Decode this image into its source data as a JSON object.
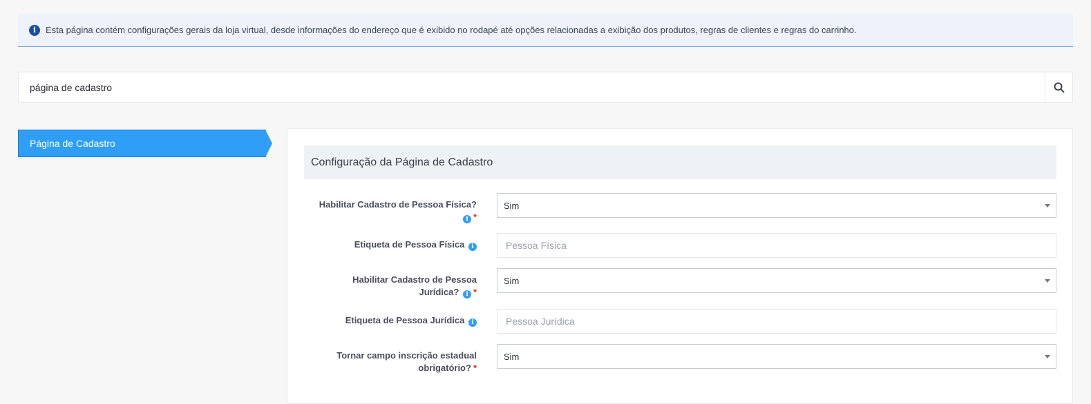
{
  "info": {
    "text": "Esta página contém configurações gerais da loja virtual, desde informações do endereço que é exibido no rodapé até opções relacionadas a exibição dos produtos, regras de clientes e regras do carrinho.",
    "icon": "info-icon"
  },
  "search": {
    "value": "página de cadastro",
    "icon": "search-icon"
  },
  "sidebar": {
    "items": [
      {
        "label": "Página de Cadastro",
        "active": true
      }
    ]
  },
  "panel": {
    "title": "Configuração da Página de Cadastro",
    "fields": [
      {
        "label_line1": "Habilitar Cadastro de Pessoa Física?",
        "label_line2": "",
        "type": "select",
        "value": "Sim",
        "required": true
      },
      {
        "label_line1": "Etiqueta de Pessoa Física",
        "label_line2": "",
        "type": "input",
        "placeholder": "Pessoa Física",
        "required": false
      },
      {
        "label_line1": "Habilitar Cadastro de Pessoa",
        "label_line2": "Jurídica?",
        "type": "select",
        "value": "Sim",
        "required": true
      },
      {
        "label_line1": "Etiqueta de Pessoa Jurídica",
        "label_line2": "",
        "type": "input",
        "placeholder": "Pessoa Jurídica",
        "required": false
      },
      {
        "label_line1": "Tornar campo inscrição estadual",
        "label_line2": "obrigatório?",
        "type": "select",
        "value": "Sim",
        "required": true
      }
    ],
    "required_mark": "*",
    "info_glyph": "i"
  },
  "colors": {
    "accent": "#2f9ef6",
    "required": "#e0252c",
    "info_dark": "#1e4f9e"
  }
}
